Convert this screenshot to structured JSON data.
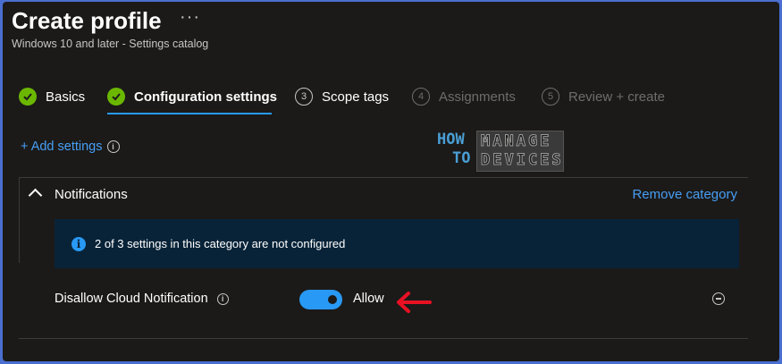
{
  "header": {
    "title": "Create profile",
    "more_label": "···",
    "subtitle": "Windows 10 and later - Settings catalog"
  },
  "steps": [
    {
      "label": "Basics",
      "state": "complete"
    },
    {
      "label": "Configuration settings",
      "state": "active"
    },
    {
      "label": "Scope tags",
      "number": "3",
      "state": "upcoming"
    },
    {
      "label": "Assignments",
      "number": "4",
      "state": "disabled"
    },
    {
      "label": "Review + create",
      "number": "5",
      "state": "disabled"
    }
  ],
  "add_settings_label": "+ Add settings",
  "watermark": {
    "line1": "HOW",
    "line2": "TO",
    "right": "MANAGE DEVICES"
  },
  "category": {
    "title": "Notifications",
    "remove_label": "Remove category",
    "info_message": "2 of 3 settings in this category are not configured",
    "settings": [
      {
        "name": "Disallow Cloud Notification",
        "toggle_on": true,
        "value_label": "Allow"
      }
    ]
  },
  "colors": {
    "background": "#1b1a19",
    "accent": "#2899f5",
    "link": "#479ef5",
    "success": "#6bb700",
    "annotation_arrow": "#e81123",
    "page_border": "#4a6fd0"
  }
}
